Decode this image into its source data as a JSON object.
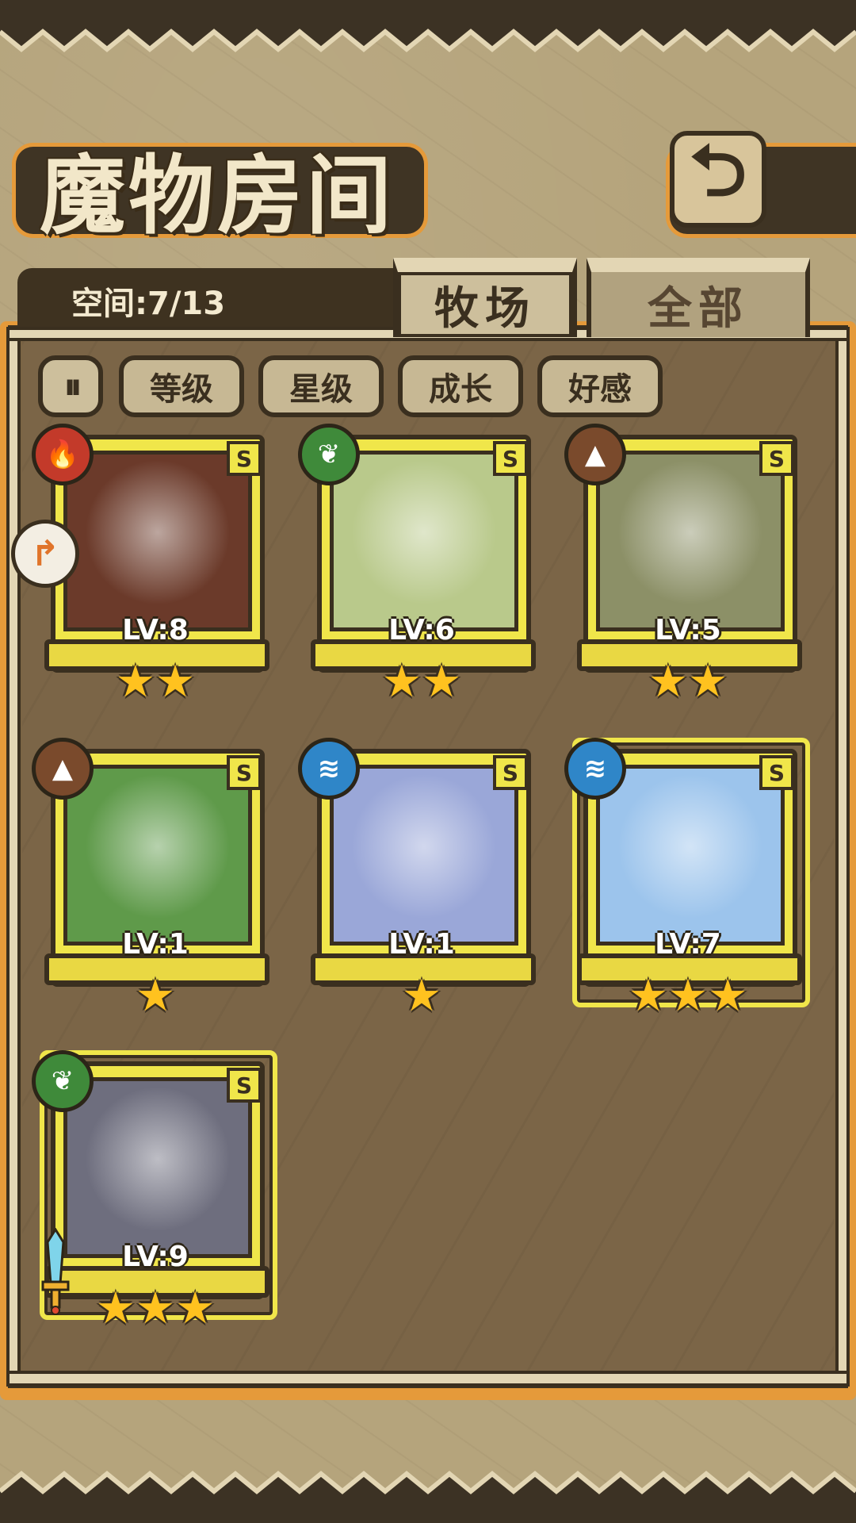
{
  "title": "魔物房间",
  "back_button": "⮌",
  "capacity": "空间:7/13",
  "tabs": [
    {
      "label": "牧场",
      "active": true
    },
    {
      "label": "全部",
      "active": false
    }
  ],
  "sort_toggle": "⏸",
  "sort_buttons": [
    "等级",
    "星级",
    "成长",
    "好感"
  ],
  "cards": [
    {
      "lv": "LV:8",
      "rank": "S",
      "element": "fire",
      "stars": 2,
      "color": "#c33a2a",
      "art": "#6b3a2a"
    },
    {
      "lv": "LV:6",
      "rank": "S",
      "element": "leaf",
      "stars": 2,
      "color": "#3f8a3a",
      "art": "#b9c98b"
    },
    {
      "lv": "LV:5",
      "rank": "S",
      "element": "earth",
      "stars": 2,
      "color": "#7a4a2c",
      "art": "#8c9067"
    },
    {
      "lv": "LV:1",
      "rank": "S",
      "element": "earth",
      "stars": 1,
      "color": "#7a4a2c",
      "art": "#5f9a4a"
    },
    {
      "lv": "LV:1",
      "rank": "S",
      "element": "water",
      "stars": 1,
      "color": "#2f86c8",
      "art": "#9aa7d8"
    },
    {
      "lv": "LV:7",
      "rank": "S",
      "element": "water",
      "stars": 3,
      "color": "#2f86c8",
      "art": "#9cc4ec"
    },
    {
      "lv": "LV:9",
      "rank": "S",
      "element": "leaf",
      "stars": 3,
      "color": "#3f8a3a",
      "art": "#6e6e7e"
    }
  ],
  "side_bubble": "↱"
}
